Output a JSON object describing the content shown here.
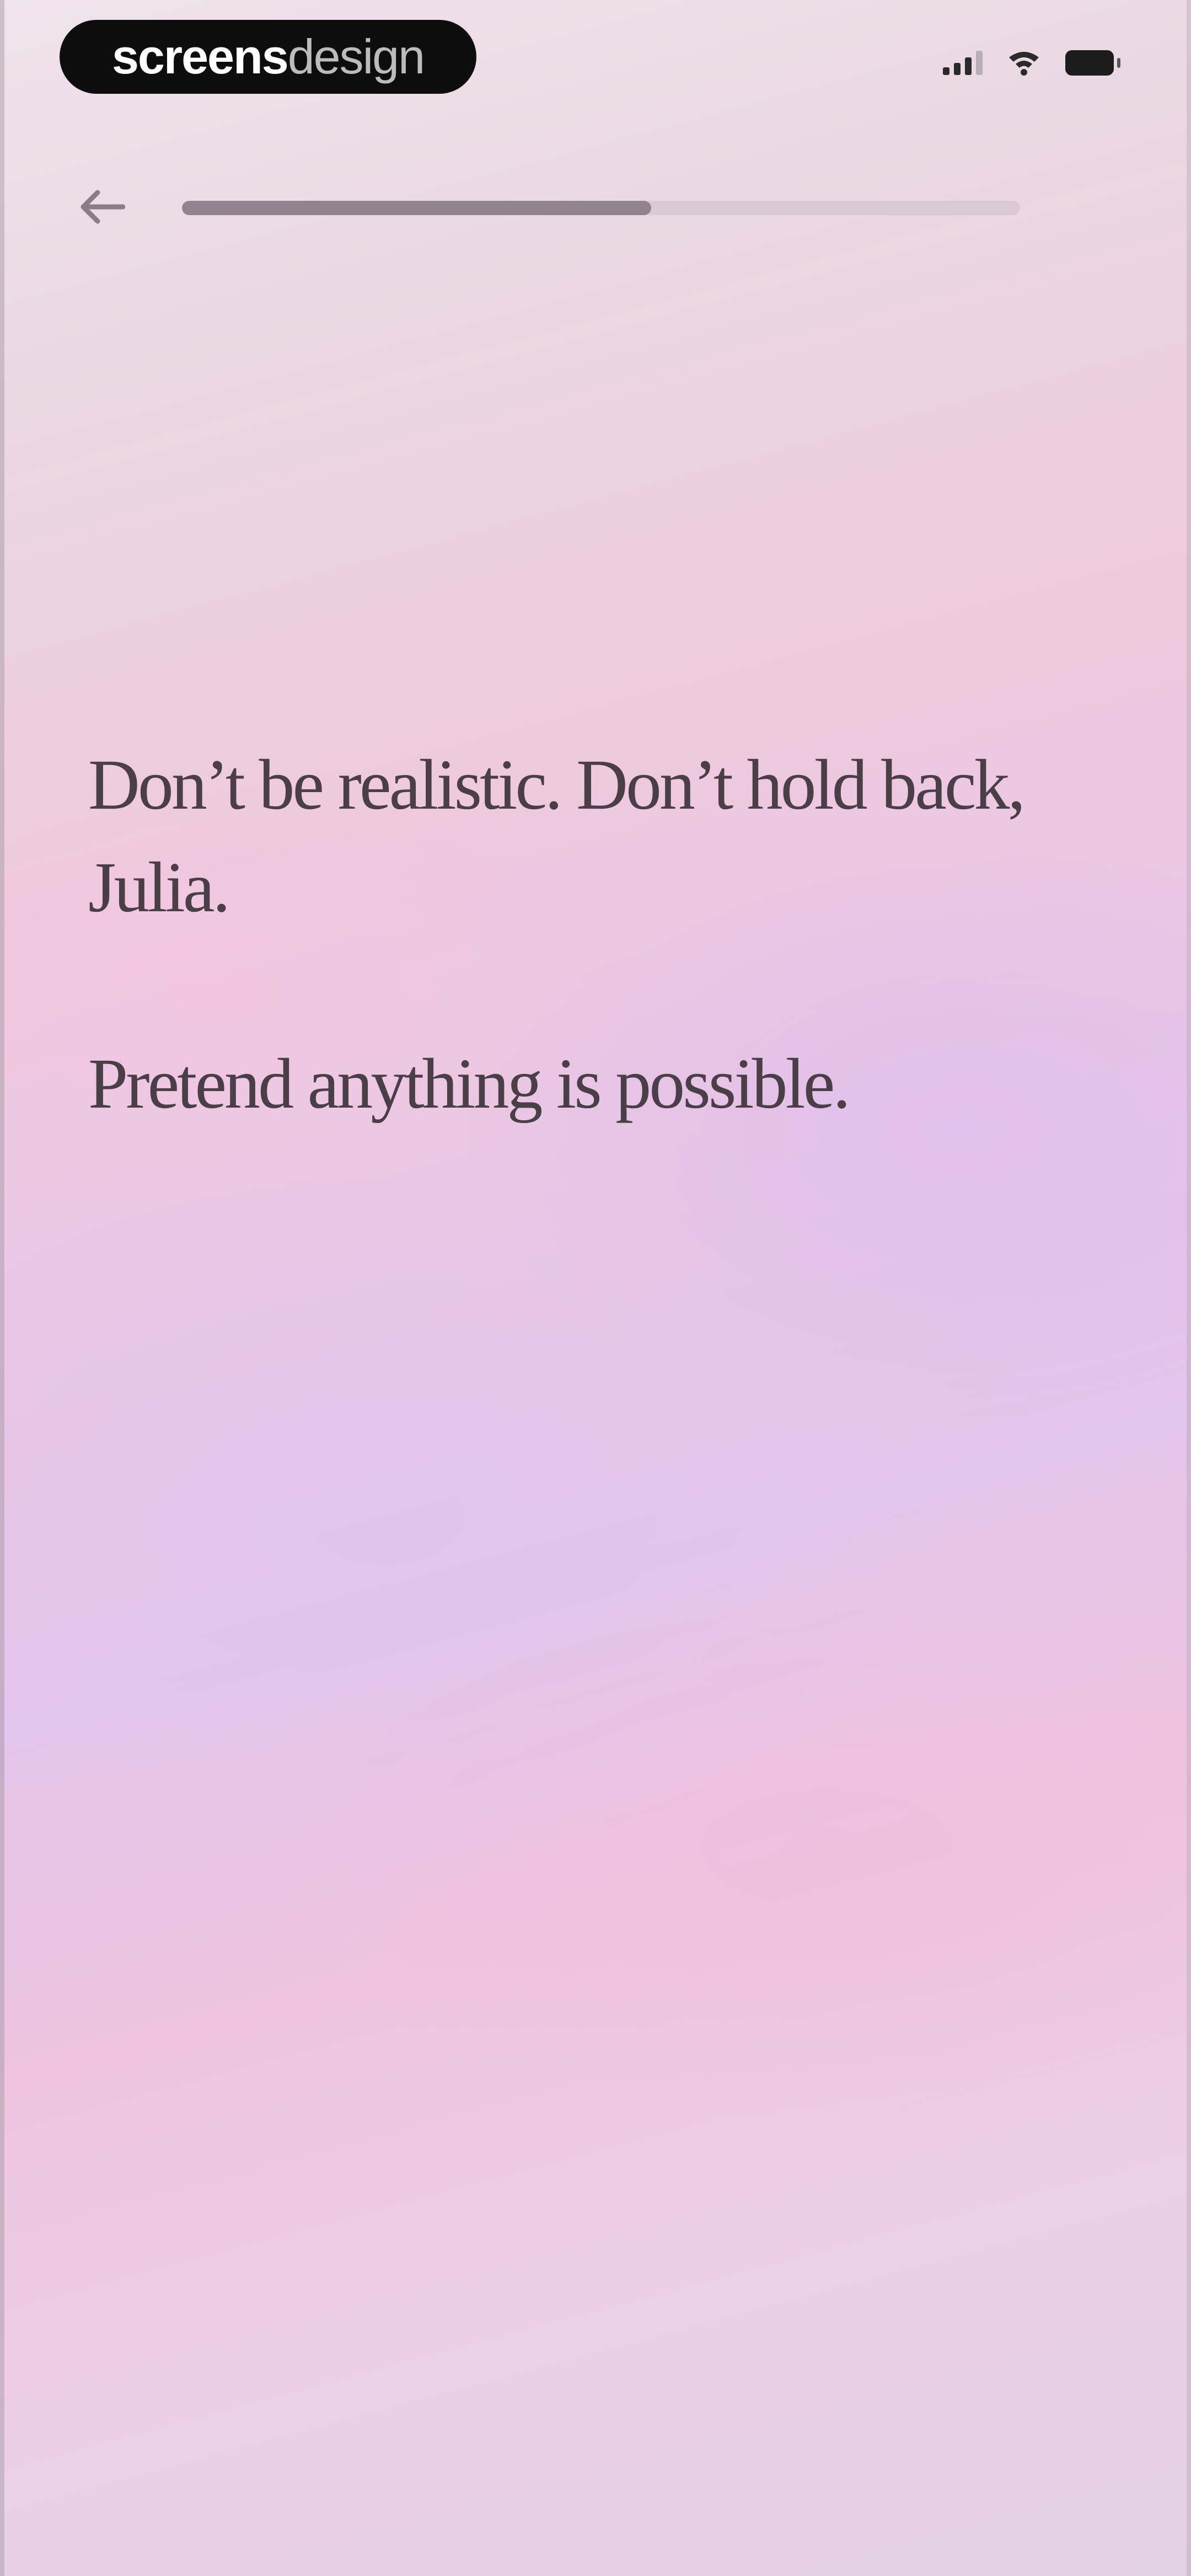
{
  "watermark": {
    "bold": "screens",
    "light": "design"
  },
  "status_bar": {
    "icons": [
      "signal-icon",
      "wifi-icon",
      "battery-icon"
    ]
  },
  "nav": {
    "back_icon": "arrow-left-icon",
    "progress_fraction": 0.56
  },
  "content": {
    "line1": "Don’t be realistic. Don’t hold back, Julia.",
    "line2": "Pretend anything is possible."
  },
  "colors": {
    "text": "#4a3f47",
    "progress_fill": "#928390",
    "background_pink": "#efc9de",
    "background_lavender": "#e3c4ea"
  }
}
